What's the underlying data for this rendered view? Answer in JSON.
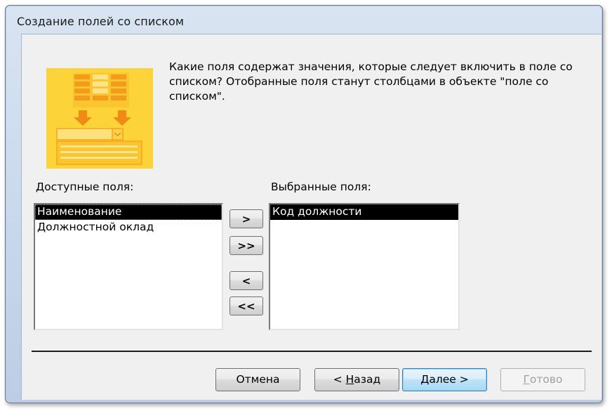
{
  "window": {
    "title": "Создание полей со списком"
  },
  "prompt": {
    "text": "Какие поля содержат значения, которые следует включить в поле со списком? Отобранные поля станут столбцами в объекте \"поле со списком\"."
  },
  "available": {
    "label": "Доступные поля:",
    "items": [
      {
        "label": "Наименование",
        "selected": true
      },
      {
        "label": "Должностной оклад",
        "selected": false
      }
    ]
  },
  "selected": {
    "label": "Выбранные поля:",
    "items": [
      {
        "label": "Код должности",
        "selected": true
      }
    ]
  },
  "move_buttons": {
    "add_one": ">",
    "add_all": ">>",
    "remove_one": "<",
    "remove_all": "<<"
  },
  "footer": {
    "cancel": "Отмена",
    "back_prefix": "< ",
    "back_hotkey": "Н",
    "back_rest": "азад",
    "next_hotkey": "Д",
    "next_rest": "алее >",
    "finish_hotkey": "Г",
    "finish_rest": "отово"
  },
  "colors": {
    "illustration_bg": "#fcd439",
    "illustration_accent": "#f5a61c",
    "selection": "#000000"
  },
  "icons": {
    "wizard_illustration": "combo-box-wizard-illustration-icon"
  }
}
